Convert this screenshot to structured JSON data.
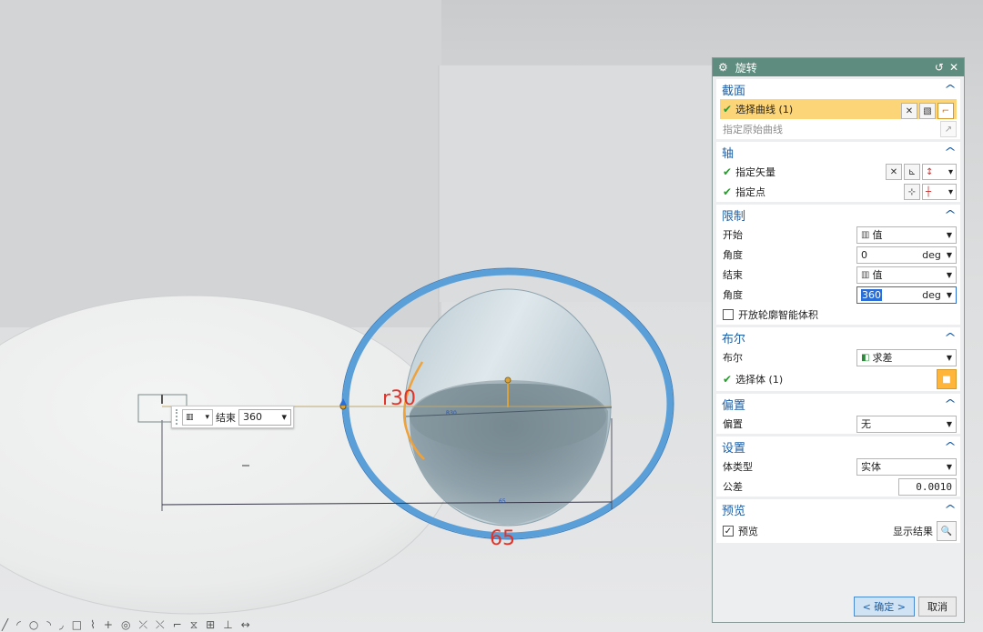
{
  "viewport": {
    "dimension_r30": "r30",
    "dimension_65": "65",
    "small_label_r30": "R30",
    "small_label_65": "65",
    "dynamic_input": {
      "end_label": "结束",
      "end_value": "360"
    }
  },
  "dialog": {
    "title": "旋转",
    "section": {
      "title": "截面",
      "select_curve": "选择曲线 (1)",
      "specify_original_curve": "指定原始曲线"
    },
    "axis": {
      "title": "轴",
      "specify_vector": "指定矢量",
      "specify_point": "指定点"
    },
    "limits": {
      "title": "限制",
      "start_label": "开始",
      "start_option": "值",
      "start_angle_label": "角度",
      "start_angle_value": "0",
      "start_angle_unit": "deg",
      "end_label": "结束",
      "end_option": "值",
      "end_angle_label": "角度",
      "end_angle_value": "360",
      "end_angle_unit": "deg",
      "open_profile_label": "开放轮廓智能体积"
    },
    "boolean": {
      "title": "布尔",
      "boolean_label": "布尔",
      "boolean_value": "求差",
      "select_body": "选择体 (1)"
    },
    "offset": {
      "title": "偏置",
      "offset_label": "偏置",
      "offset_value": "无"
    },
    "settings": {
      "title": "设置",
      "body_type_label": "体类型",
      "body_type_value": "实体",
      "tolerance_label": "公差",
      "tolerance_value": "0.0010"
    },
    "preview": {
      "title": "预览",
      "preview_label": "预览",
      "show_result_label": "显示结果"
    },
    "ok_label": "< 确定 >",
    "cancel_label": "取消"
  },
  "colors": {
    "title_bar": "#5e8c7e",
    "section_title": "#1d5fa5",
    "highlight_row": "#fcd579",
    "dimension_red": "#e0342a",
    "ring_blue": "#5a9fd8"
  }
}
